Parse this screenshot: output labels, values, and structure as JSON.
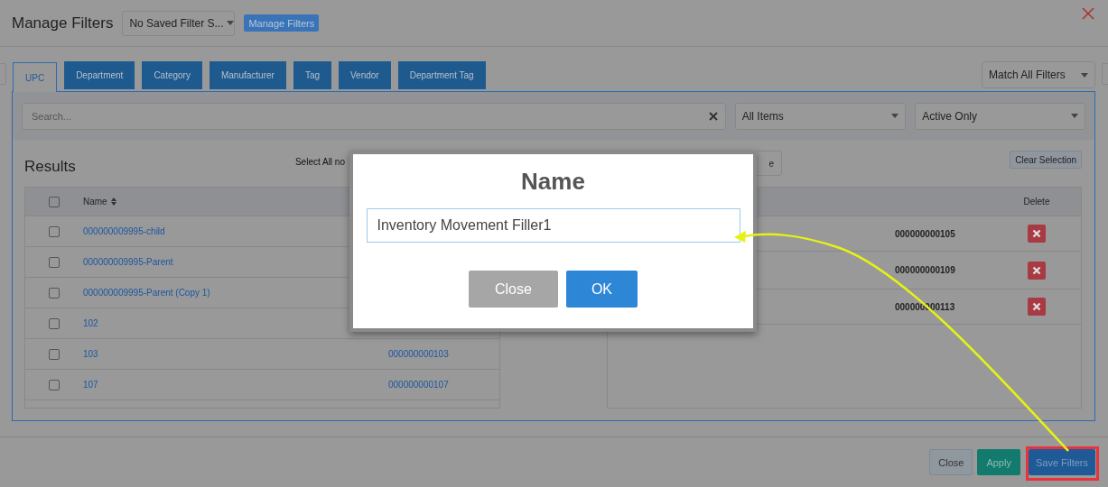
{
  "window": {
    "title": "Manage Filters"
  },
  "saved_filter_select": {
    "value": "No Saved Filter S..."
  },
  "manage_filters_button": "Manage Filters",
  "tabs": [
    {
      "label": "UPC",
      "selected": true
    },
    {
      "label": "Department",
      "selected": false
    },
    {
      "label": "Category",
      "selected": false
    },
    {
      "label": "Manufacturer",
      "selected": false
    },
    {
      "label": "Tag",
      "selected": false
    },
    {
      "label": "Vendor",
      "selected": false
    },
    {
      "label": "Department Tag",
      "selected": false
    }
  ],
  "match_select": {
    "value": "Match All Filters"
  },
  "search": {
    "placeholder": "Search..."
  },
  "item_filter": {
    "value": "All Items"
  },
  "status_filter": {
    "value": "Active Only"
  },
  "results": {
    "title": "Results",
    "select_all": "Select All no",
    "all_checked": false,
    "columns": [
      "Name"
    ],
    "rows": [
      {
        "name": "000000009995-child",
        "checked": false
      },
      {
        "name": "000000009995-Parent",
        "checked": false
      },
      {
        "name": "000000009995-Parent (Copy 1)",
        "checked": false
      },
      {
        "name": "102",
        "checked": false
      },
      {
        "name": "103",
        "column_2": "000000000103",
        "checked": false
      },
      {
        "name": "107",
        "column_2": "000000000107",
        "checked": false
      }
    ]
  },
  "selection": {
    "partial_button": "e",
    "clear_button": "Clear Selection",
    "columns": [
      "Delete"
    ],
    "rows": [
      {
        "column_2": "000000000105"
      },
      {
        "column_2": "000000000109"
      },
      {
        "column_2": "000000000113"
      }
    ]
  },
  "footer_buttons": [
    {
      "label": "Close",
      "kind": "default"
    },
    {
      "label": "Apply",
      "kind": "success"
    },
    {
      "label": "Save Filters",
      "kind": "primary"
    }
  ],
  "dialog": {
    "title": "Name",
    "value": "Inventory Movement Filler1",
    "buttons": [
      {
        "label": "Close",
        "kind": "secondary"
      },
      {
        "label": "OK",
        "kind": "primary"
      }
    ]
  }
}
